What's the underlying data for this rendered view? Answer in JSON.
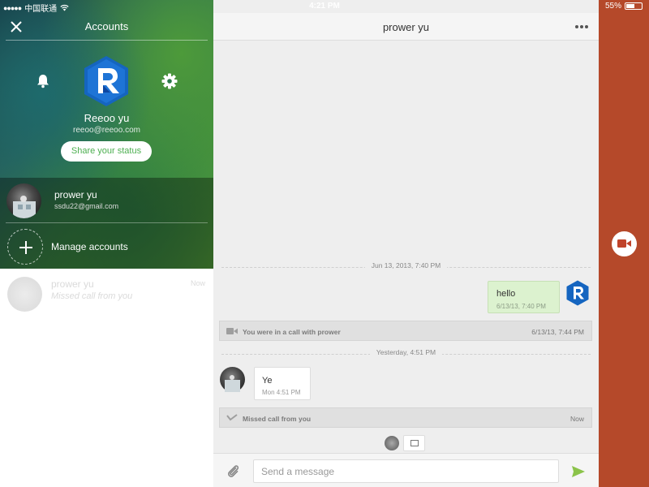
{
  "status_bar": {
    "carrier": "中国联通",
    "time": "4:21 PM",
    "battery": "55%",
    "battery_level": 0.55
  },
  "accounts_panel": {
    "title": "Accounts",
    "profile": {
      "name": "Reeoo yu",
      "email": "reeoo@reeoo.com"
    },
    "share_status_label": "Share your status",
    "accounts": [
      {
        "name": "prower yu",
        "email": "ssdu22@gmail.com"
      }
    ],
    "manage_label": "Manage accounts",
    "background_conversation": {
      "name": "prower yu",
      "preview": "Missed call from you",
      "time": "Now"
    }
  },
  "chat": {
    "title": "prower yu",
    "dividers": [
      "Jun 13, 2013, 7:40 PM",
      "Yesterday, 4:51 PM"
    ],
    "outgoing": {
      "text": "hello",
      "time": "6/13/13, 7:40 PM"
    },
    "call_event": {
      "text": "You were in a call with prower",
      "time": "6/13/13, 7:44 PM"
    },
    "incoming": {
      "text": "Ye",
      "time": "Mon 4:51 PM"
    },
    "missed_event": {
      "text": "Missed call from you",
      "time": "Now"
    },
    "composer": {
      "placeholder": "Send a message"
    }
  },
  "colors": {
    "accent_green": "#4caf50",
    "brand_blue": "#1565c0",
    "side_background": "#b5492a"
  }
}
